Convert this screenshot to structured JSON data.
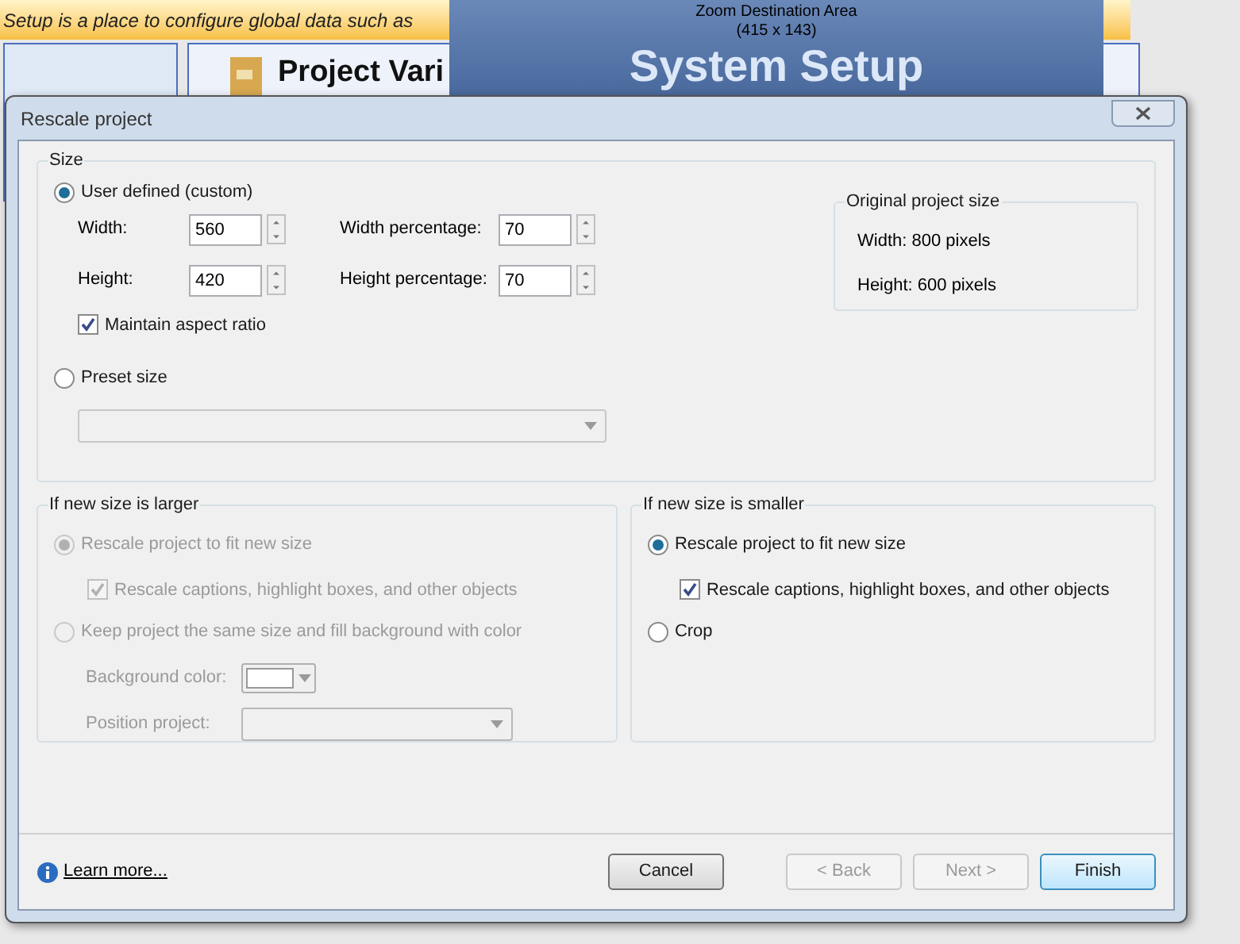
{
  "background_app": {
    "banner": "Setup is a place to configure global data such as",
    "card_title": "Project Vari",
    "zoom_overlay": {
      "heading": "System Setup",
      "label": "Zoom Destination Area",
      "size": "(415 x 143)"
    }
  },
  "window": {
    "title": "Rescale project"
  },
  "size_group": {
    "title": "Size",
    "user_defined": {
      "label": "User defined (custom)",
      "selected": true
    },
    "fields": [
      {
        "label": "Width:",
        "value": "560",
        "pct_label": "Width percentage:",
        "pct_value": "70"
      },
      {
        "label": "Height:",
        "value": "420",
        "pct_label": "Height percentage:",
        "pct_value": "70"
      }
    ],
    "maintain_aspect": {
      "label": "Maintain aspect ratio",
      "checked": true
    },
    "preset": {
      "label": "Preset size",
      "selected": false
    },
    "original": {
      "title": "Original project size",
      "lines": [
        "Width: 800 pixels",
        "Height: 600 pixels"
      ]
    }
  },
  "larger_group": {
    "title": "If new size is larger",
    "disabled": true,
    "rescale": {
      "label": "Rescale project to fit new size",
      "selected": true
    },
    "rescale_objects": {
      "label": "Rescale captions, highlight boxes, and other objects",
      "checked": true
    },
    "keep": {
      "label": "Keep project the same size and fill background with color",
      "selected": false
    },
    "background_color": {
      "label": "Background color:"
    },
    "position": {
      "label": "Position project:"
    }
  },
  "smaller_group": {
    "title": "If new size is smaller",
    "disabled": false,
    "rescale": {
      "label": "Rescale project to fit new size",
      "selected": true
    },
    "rescale_objects": {
      "label": "Rescale captions, highlight boxes, and other objects",
      "checked": true
    },
    "crop": {
      "label": "Crop",
      "selected": false
    }
  },
  "footer": {
    "link": "Learn more...",
    "buttons": [
      {
        "label": "Cancel",
        "kind": "normal",
        "disabled": false
      },
      {
        "label": "< Back",
        "kind": "normal",
        "disabled": true
      },
      {
        "label": "Next >",
        "kind": "normal",
        "disabled": true
      },
      {
        "label": "Finish",
        "kind": "default",
        "disabled": false
      }
    ]
  }
}
